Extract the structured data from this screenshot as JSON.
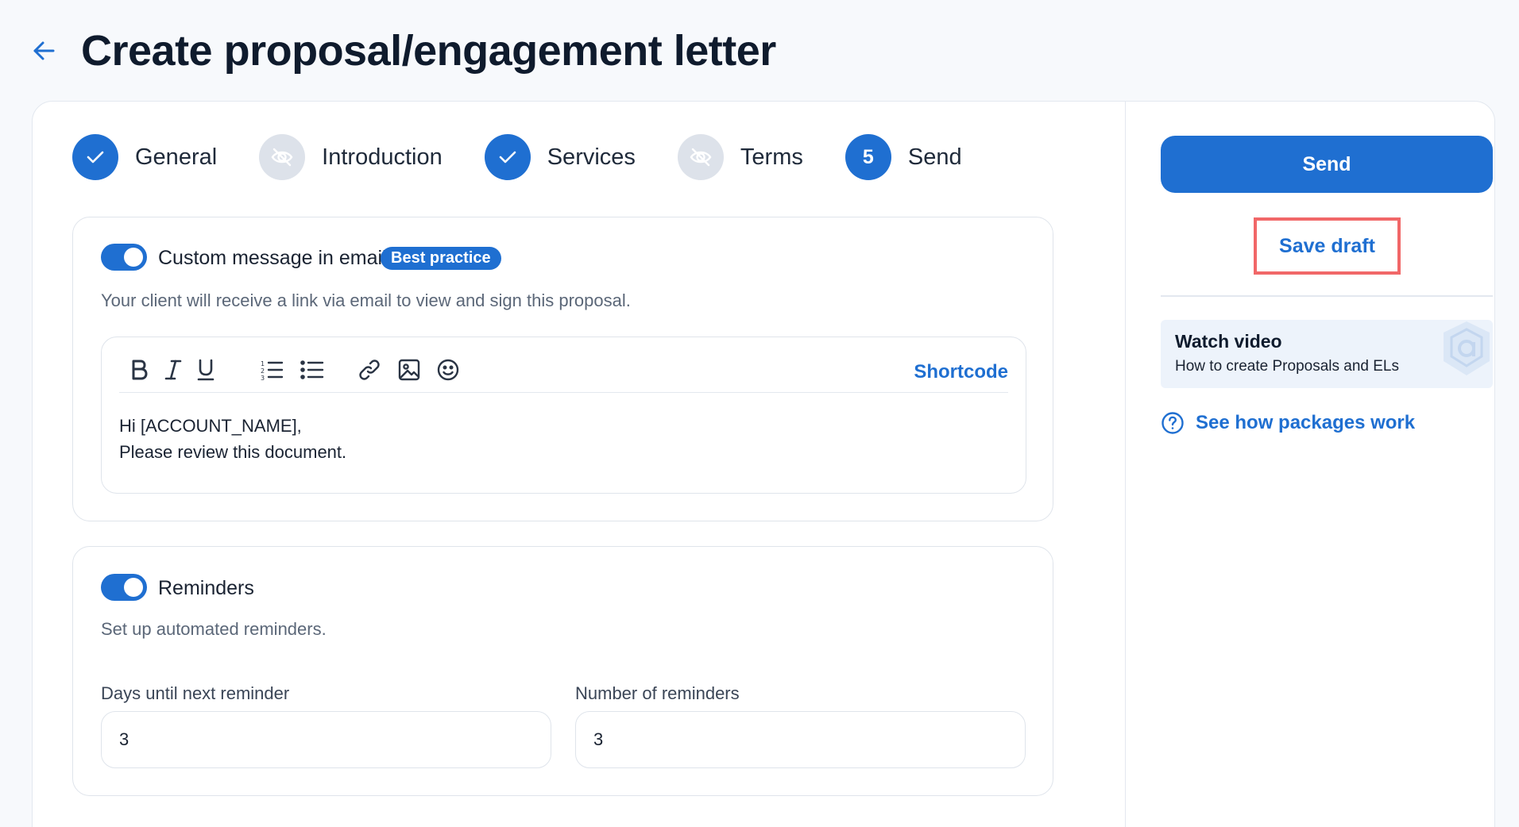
{
  "header": {
    "title": "Create proposal/engagement letter"
  },
  "stepper": {
    "steps": [
      {
        "label": "General",
        "state": "done"
      },
      {
        "label": "Introduction",
        "state": "skipped"
      },
      {
        "label": "Services",
        "state": "done"
      },
      {
        "label": "Terms",
        "state": "skipped"
      },
      {
        "label": "Send",
        "state": "active",
        "number": "5"
      }
    ]
  },
  "custom_message": {
    "enabled": true,
    "title": "Custom message in email",
    "badge": "Best practice",
    "description": "Your client will receive a link via email to view and sign this proposal.",
    "toolbar": {
      "bold": "B",
      "shortcode": "Shortcode"
    },
    "body_line1": "Hi [ACCOUNT_NAME],",
    "body_line2": "Please review this document."
  },
  "reminders": {
    "enabled": true,
    "title": "Reminders",
    "description": "Set up automated reminders.",
    "days_label": "Days until next reminder",
    "days_value": "3",
    "count_label": "Number of reminders",
    "count_value": "3"
  },
  "sidebar": {
    "send_label": "Send",
    "save_draft_label": "Save draft",
    "video_title": "Watch video",
    "video_subtitle": "How to create Proposals and ELs",
    "help_link": "See how packages work"
  },
  "colors": {
    "accent": "#1f6fd1",
    "highlight": "#f16768"
  }
}
